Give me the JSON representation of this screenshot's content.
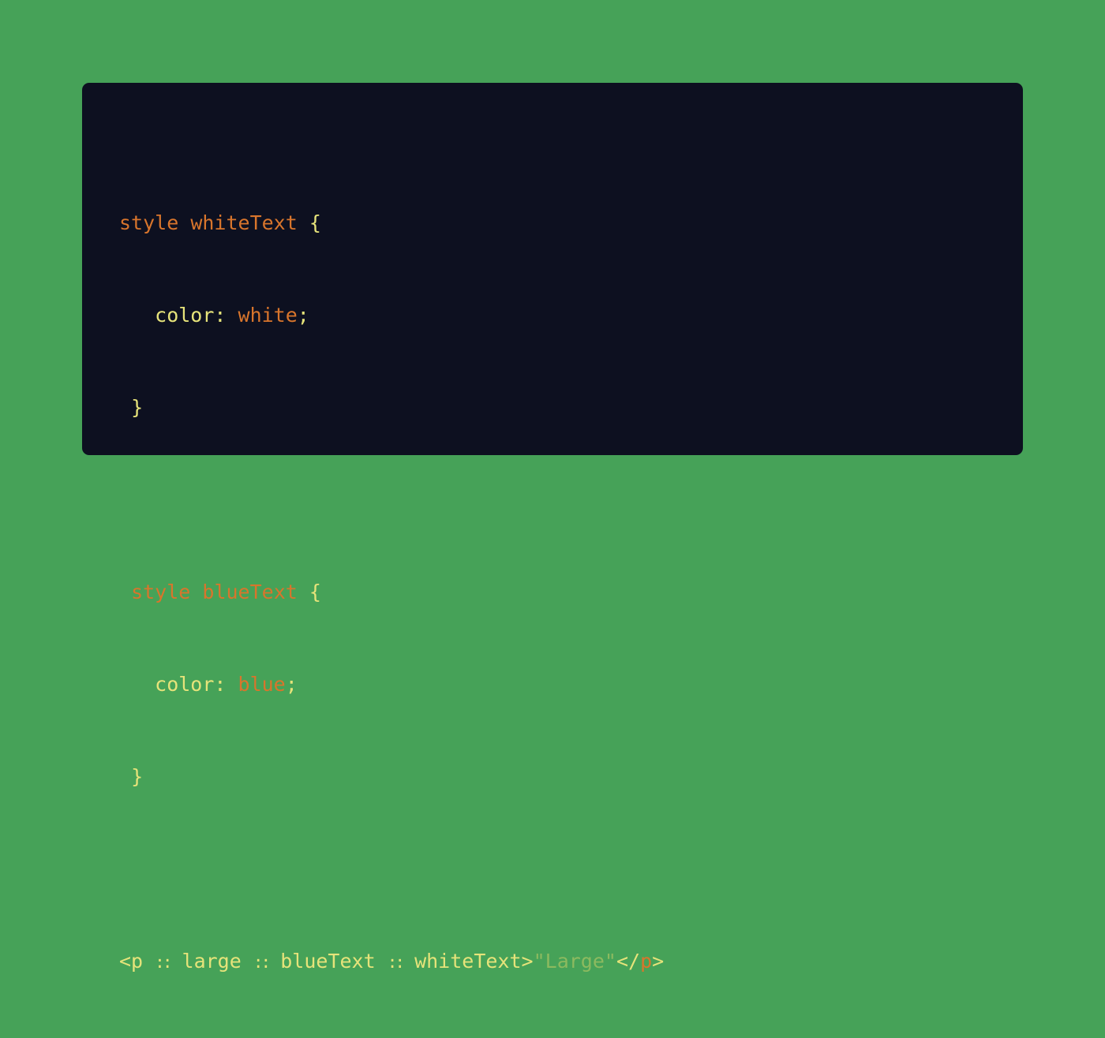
{
  "code": {
    "line1": {
      "kw1": "style",
      "name": "whiteText",
      "brace": "{"
    },
    "line2": {
      "prop": "color:",
      "val": "white",
      "semi": ";"
    },
    "line3": {
      "brace": "}"
    },
    "line5": {
      "kw1": "style",
      "name": "blueText",
      "brace": "{"
    },
    "line6": {
      "prop": "color:",
      "val": "blue",
      "semi": ";"
    },
    "line7": {
      "brace": "}"
    },
    "line9": {
      "open": "<p",
      "sep": "::",
      "t1": "large",
      "t2": "blueText",
      "t3": "whiteText",
      "gt": ">",
      "str": "\"Large\"",
      "close_open": "</",
      "close_tag": "p",
      "close_gt": ">"
    }
  },
  "colors": {
    "background": "#46a258",
    "card": "#0d1020",
    "keyword": "#d8752c",
    "identifier": "#e6e37a",
    "string": "#8cba5f"
  }
}
